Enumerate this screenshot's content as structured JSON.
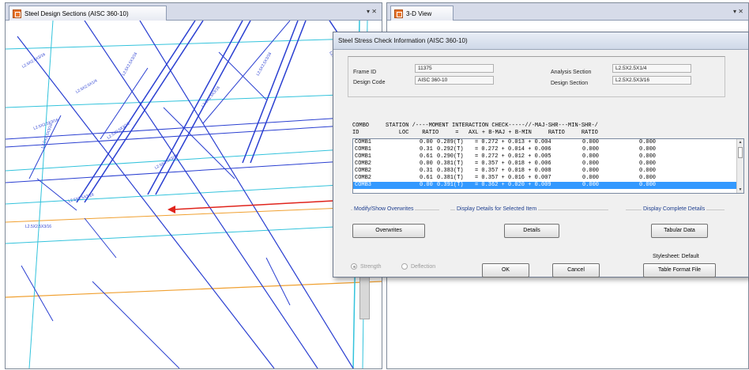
{
  "left_pane": {
    "title": "Steel Design Sections  (AISC 360-10)",
    "controls": "▾ ✕",
    "member_labels": [
      "L2.5X2.5X3/16",
      "L2.5X2.5X1/4",
      "L2.5X2.5X3/16",
      "L2.5X2.5X3/16",
      "L2.5X2.5X3/16",
      "L2.5X2.5X3/16",
      "L2.5X2.5X3/16",
      "L2.5X2.5X3/16",
      "L2.5X2.5X3/16",
      "L2.5X2.5X3/16",
      "L2.5X2.5X3/16",
      "L2.5X2.5X3/16"
    ]
  },
  "right_pane": {
    "title": "3-D View",
    "controls": "▾ ✕"
  },
  "dialog": {
    "title": "Steel Stress Check Information (AISC 360-10)",
    "frame_id_label": "Frame ID",
    "frame_id": "11375",
    "design_code_label": "Design Code",
    "design_code": "AISC 360-10",
    "analysis_section_label": "Analysis Section",
    "analysis_section": "L2.5X2.5X1/4",
    "design_section_label": "Design Section",
    "design_section": "L2.5X2.5X3/16",
    "header_line1": "COMBO     STATION /----MOMENT INTERACTION CHECK-----//-MAJ-SHR---MIN-SHR-/",
    "header_line2": "ID            LOC    RATIO     =   AXL + B-MAJ + B-MIN     RATIO     RATIO",
    "rows": [
      {
        "combo": "COMB1",
        "loc": "0.00",
        "ratio": "0.289(T)",
        "eq": "= 0.272 + 0.013 + 0.004",
        "maj": "0.000",
        "min": "0.000"
      },
      {
        "combo": "COMB1",
        "loc": "0.31",
        "ratio": "0.292(T)",
        "eq": "= 0.272 + 0.014 + 0.006",
        "maj": "0.000",
        "min": "0.000"
      },
      {
        "combo": "COMB1",
        "loc": "0.61",
        "ratio": "0.290(T)",
        "eq": "= 0.272 + 0.012 + 0.005",
        "maj": "0.000",
        "min": "0.000"
      },
      {
        "combo": "COMB2",
        "loc": "0.00",
        "ratio": "0.381(T)",
        "eq": "= 0.357 + 0.018 + 0.006",
        "maj": "0.000",
        "min": "0.000"
      },
      {
        "combo": "COMB2",
        "loc": "0.31",
        "ratio": "0.383(T)",
        "eq": "= 0.357 + 0.018 + 0.008",
        "maj": "0.000",
        "min": "0.000"
      },
      {
        "combo": "COMB2",
        "loc": "0.61",
        "ratio": "0.381(T)",
        "eq": "= 0.357 + 0.016 + 0.007",
        "maj": "0.000",
        "min": "0.000"
      },
      {
        "combo": "COMB3",
        "loc": "0.00",
        "ratio": "0.391(T)",
        "eq": "= 0.362 + 0.020 + 0.009",
        "maj": "0.000",
        "min": "0.000"
      }
    ],
    "overwrites_group": "Modify/Show Overwrites",
    "overwrites_button": "Overwrites",
    "details_group": "Display Details for Selected Item",
    "details_button": "Details",
    "complete_group": "Display Complete Details",
    "tabular_button": "Tabular Data",
    "stylesheet": "Stylesheet: Default",
    "format_button": "Table Format File",
    "strength_label": "Strength",
    "deflection_label": "Deflection",
    "ok_button": "OK",
    "cancel_button": "Cancel"
  },
  "colors": {
    "member_blue": "#2a3fd1",
    "frame_cyan": "#33c3dc",
    "orange_line": "#f0a030",
    "arrow_red": "#e0241c",
    "selection": "#3399ff"
  }
}
